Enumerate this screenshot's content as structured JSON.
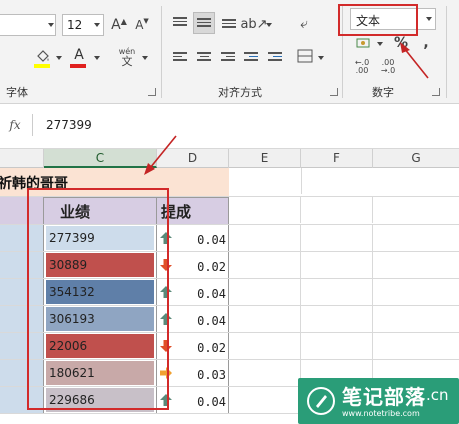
{
  "ribbon": {
    "font_size": "12",
    "font_group_label": "字体",
    "align_group_label": "对齐方式",
    "number_group_label": "数字",
    "number_format_value": "文本",
    "percent_symbol": "%",
    "comma_symbol": ",",
    "grow_font": "A",
    "shrink_font": "A",
    "wen_label": "wén"
  },
  "formula_bar": {
    "fx_label": "fx",
    "value": "277399"
  },
  "columns": [
    "C",
    "D",
    "E",
    "F",
    "G"
  ],
  "title_fragment": "祈韩的哥哥",
  "headers": {
    "c": "业绩",
    "d": "提成"
  },
  "rows": [
    {
      "value": "277399",
      "rate": "0.04",
      "fill": "#cddceb",
      "trend": "up"
    },
    {
      "value": "30889",
      "rate": "0.02",
      "fill": "#c0504d",
      "trend": "down"
    },
    {
      "value": "354132",
      "rate": "0.04",
      "fill": "#5f7fa8",
      "trend": "up"
    },
    {
      "value": "306193",
      "rate": "0.04",
      "fill": "#8fa5c2",
      "trend": "up"
    },
    {
      "value": "22006",
      "rate": "0.02",
      "fill": "#c0504d",
      "trend": "down"
    },
    {
      "value": "180621",
      "rate": "0.03",
      "fill": "#c8a9a8",
      "trend": "right"
    },
    {
      "value": "229686",
      "rate": "0.04",
      "fill": "#c8c0c8",
      "trend": "up"
    }
  ],
  "watermark": {
    "title": "笔记部落",
    "url": "www.notetribe.com",
    "suffix": ".cn"
  },
  "colors": {
    "accent_green": "#217346",
    "annotation_red": "#d22a2a",
    "header_purple": "#d7cde3",
    "title_peach": "#fbe3d3",
    "arrow_green": "#5a8a7a",
    "arrow_red": "#e0502a",
    "arrow_orange": "#f0a030"
  }
}
